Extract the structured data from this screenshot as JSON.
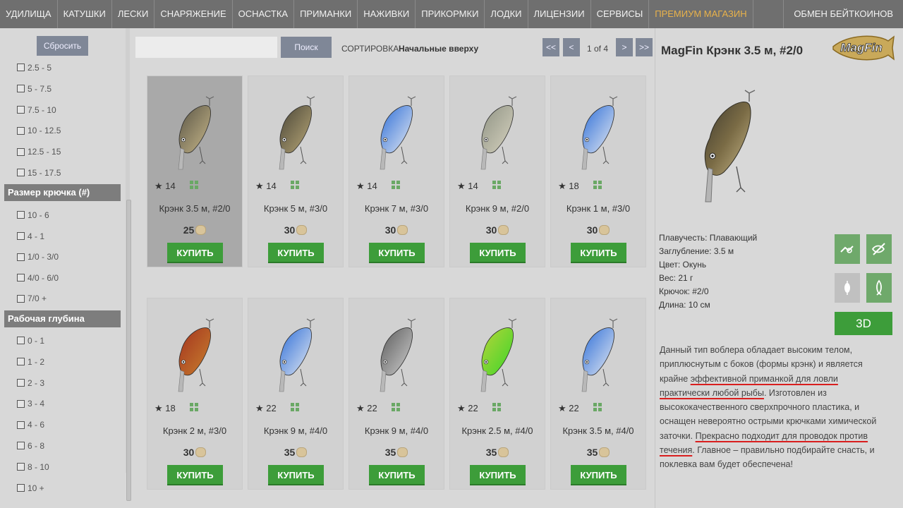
{
  "nav": {
    "items": [
      "УДИЛИЩА",
      "КАТУШКИ",
      "ЛЕСКИ",
      "СНАРЯЖЕНИЕ",
      "ОСНАСТКА",
      "ПРИМАНКИ",
      "НАЖИВКИ",
      "ПРИКОРМКИ",
      "ЛОДКИ",
      "ЛИЦЕНЗИИ",
      "СЕРВИСЫ"
    ],
    "premium": "ПРЕМИУМ МАГАЗИН",
    "exchange": "ОБМЕН БЕЙТКОИНОВ"
  },
  "sidebar": {
    "reset_label": "Сбросить",
    "weight_items": [
      "2.5 - 5",
      "5 - 7.5",
      "7.5 - 10",
      "10 - 12.5",
      "12.5 - 15",
      "15 - 17.5"
    ],
    "hook_header": "Размер крючка (#)",
    "hook_items": [
      "10 - 6",
      "4 - 1",
      "1/0 - 3/0",
      "4/0 - 6/0",
      "7/0 +"
    ],
    "depth_header": "Рабочая глубина",
    "depth_items": [
      "0 - 1",
      "1 - 2",
      "2 - 3",
      "3 - 4",
      "4 - 6",
      "6 - 8",
      "8 - 10",
      "10 +"
    ]
  },
  "toolbar": {
    "search_placeholder": "",
    "search_label": "Поиск",
    "sort_label": "СОРТИРОВКА:",
    "sort_value": "Начальные вверху",
    "first": "<<",
    "prev": "<",
    "next": ">",
    "last": ">>",
    "page": "1 of 4"
  },
  "products": [
    {
      "name": "Крэнк 3.5 м, #2/0",
      "rating": "14",
      "price": "25",
      "buy": "КУПИТЬ",
      "color": "#5a5546",
      "belly": "#c8b88a",
      "selected": true
    },
    {
      "name": "Крэнк 5 м, #3/0",
      "rating": "14",
      "price": "30",
      "buy": "КУПИТЬ",
      "color": "#4a4638",
      "belly": "#b9a878"
    },
    {
      "name": "Крэнк 7 м, #3/0",
      "rating": "14",
      "price": "30",
      "buy": "КУПИТЬ",
      "color": "#2f6fd8",
      "belly": "#e4e9f2"
    },
    {
      "name": "Крэнк 9 м, #2/0",
      "rating": "14",
      "price": "30",
      "buy": "КУПИТЬ",
      "color": "#8f9384",
      "belly": "#d7d3c0"
    },
    {
      "name": "Крэнк 1 м, #3/0",
      "rating": "18",
      "price": "30",
      "buy": "КУПИТЬ",
      "color": "#2f6fd8",
      "belly": "#e4e9f2"
    },
    {
      "name": "Крэнк 2 м, #3/0",
      "rating": "18",
      "price": "30",
      "buy": "КУПИТЬ",
      "color": "#a3331f",
      "belly": "#c9812e"
    },
    {
      "name": "Крэнк 9 м, #4/0",
      "rating": "22",
      "price": "35",
      "buy": "КУПИТЬ",
      "color": "#2f6fd8",
      "belly": "#e4e9f2"
    },
    {
      "name": "Крэнк 9 м, #4/0",
      "rating": "22",
      "price": "35",
      "buy": "КУПИТЬ",
      "color": "#5b5b5b",
      "belly": "#cfcfcf"
    },
    {
      "name": "Крэнк 2.5 м, #4/0",
      "rating": "22",
      "price": "35",
      "buy": "КУПИТЬ",
      "color": "#b7d43a",
      "belly": "#3bd62a"
    },
    {
      "name": "Крэнк 3.5 м, #4/0",
      "rating": "22",
      "price": "35",
      "buy": "КУПИТЬ",
      "color": "#2f6fd8",
      "belly": "#e4e9f2"
    }
  ],
  "details": {
    "title": "MagFin Крэнк 3.5 м, #2/0",
    "brand": "MagFin",
    "attrs": [
      "Плавучесть: Плавающий",
      "Заглубление: 3.5 м",
      "Цвет: Окунь",
      "Вес: 21 г",
      "Крючок: #2/0",
      "Длина: 10 см"
    ],
    "btn_3d": "3D",
    "desc": {
      "p1": "Данный тип воблера обладает высоким телом, приплюснутым с боков (формы крэнк) и является крайне ",
      "u1": "эффективной приманкой для ловли практически любой рыбы",
      "p2": ". Изготовлен из высококачественного сверхпрочного пластика, и оснащен невероятно острыми крючками химической заточки. ",
      "u2": "Прекрасно подходит для проводок против течения",
      "p3": ". Главное – правильно подбирайте снасть, и поклевка вам будет обеспечена!"
    }
  },
  "icons": {
    "star": "star-icon",
    "grid": "grid-icon",
    "coin": "baitcoin-icon",
    "actions": [
      "hand-reel-icon",
      "no-fish-icon",
      "float-icon",
      "fish-icon"
    ]
  }
}
